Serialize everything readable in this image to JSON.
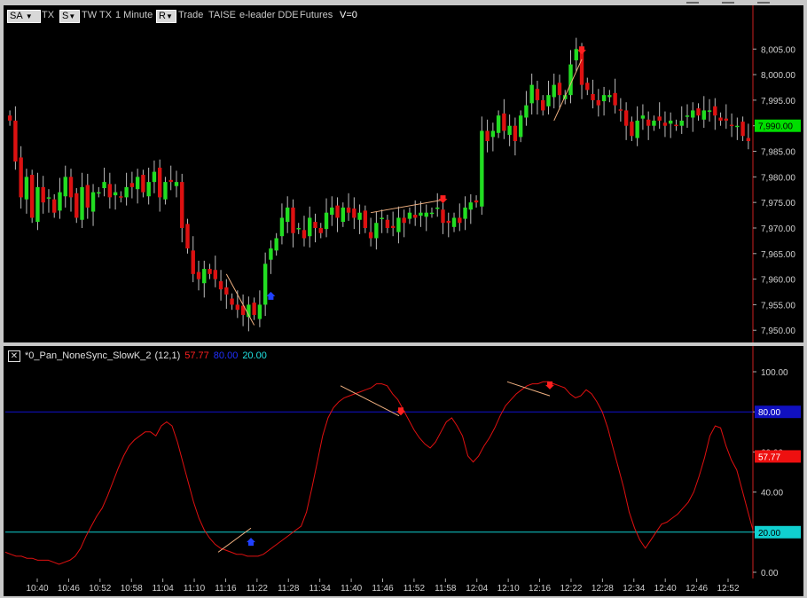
{
  "toolbar": {
    "symbol_button": "SA",
    "symbol": "TX",
    "session_button": "S",
    "exchange_symbol": "TW TX",
    "interval": "1 Minute",
    "replay_button": "R",
    "data_type": "Trade",
    "exchange": "TAISE",
    "feed": "e-leader DDE",
    "category": "Futures",
    "volume_label": "V=0"
  },
  "indicator": {
    "name": "*0_Pan_NoneSync_SlowK_2",
    "params": "(12,1)",
    "value_red": "57.77",
    "value_blue": "80.00",
    "value_cyan": "20.00"
  },
  "colors": {
    "up_candle": "#22dd22",
    "down_candle": "#dd1111",
    "slowk_line": "#e01010",
    "overbought_line": "#1010d0",
    "oversold_line": "#10d0d0",
    "divergence_line": "#f0b080",
    "sell_marker": "#ff2020",
    "buy_marker": "#2040ff",
    "price_tag": "#00dd00"
  },
  "chart_data": [
    {
      "type": "candlestick",
      "title": "TX 1 Minute",
      "ylim": [
        7949,
        8008
      ],
      "y_ticks": [
        "8,005.00",
        "8,000.00",
        "7,995.00",
        "7,990.00",
        "7,985.00",
        "7,980.00",
        "7,975.00",
        "7,970.00",
        "7,965.00",
        "7,960.00",
        "7,955.00",
        "7,950.00"
      ],
      "last_price": "7,990.00",
      "x_ticks": [
        "10:40",
        "10:46",
        "10:52",
        "10:58",
        "11:04",
        "11:10",
        "11:16",
        "11:22",
        "11:28",
        "11:34",
        "11:40",
        "11:46",
        "11:52",
        "11:58",
        "12:04",
        "12:10",
        "12:16",
        "12:22",
        "12:28",
        "12:34",
        "12:40",
        "12:46",
        "12:52"
      ],
      "closes": [
        7991,
        7983,
        7976,
        7980,
        7972,
        7978,
        7975,
        7976,
        7973,
        7977,
        7980,
        7976,
        7972,
        7978,
        7974,
        7977,
        7977,
        7979,
        7976,
        7977,
        7976,
        7978,
        7978,
        7980,
        7977,
        7979,
        7981,
        7976,
        7979,
        7979,
        7979,
        7970,
        7966,
        7961,
        7960,
        7962,
        7961,
        7960,
        7958,
        7957,
        7955,
        7954,
        7953,
        7955,
        7953,
        7955,
        7963,
        7966,
        7968,
        7972,
        7974,
        7969,
        7970,
        7968,
        7972,
        7970,
        7969,
        7973,
        7974,
        7972,
        7974,
        7973,
        7972,
        7973,
        7970,
        7968,
        7971,
        7972,
        7970,
        7970,
        7972,
        7971,
        7973,
        7972,
        7973,
        7973,
        7973,
        7974,
        7971,
        7971,
        7972,
        7971,
        7974,
        7975,
        7975,
        7989,
        7987,
        7989,
        7992,
        7989,
        7990,
        7987,
        7992,
        7994,
        7998,
        7995,
        7993,
        7996,
        7998,
        7996,
        7996,
        8002,
        8005,
        7998,
        7997,
        7995,
        7994,
        7996,
        7996,
        7994,
        7993,
        7990,
        7988,
        7991,
        7992,
        7990,
        7991,
        7991,
        7990,
        7991,
        7990,
        7991,
        7992,
        7993,
        7992,
        7993,
        7993,
        7992,
        7991,
        7991,
        7990,
        7990,
        7988,
        7987
      ],
      "series": [
        {
          "name": "up"
        },
        {
          "name": "down"
        }
      ]
    },
    {
      "type": "line",
      "ylim": [
        0,
        100
      ],
      "y_ticks": [
        "100.00",
        "80.00",
        "60.00",
        "40.00",
        "20.00",
        "0.00"
      ],
      "levels": [
        80,
        20
      ],
      "last_value": 57.77,
      "values": [
        10,
        9,
        8,
        8,
        7,
        7,
        6,
        6,
        6,
        5,
        4,
        5,
        6,
        8,
        12,
        18,
        23,
        28,
        32,
        38,
        45,
        52,
        58,
        63,
        66,
        68,
        70,
        70,
        68,
        73,
        75,
        73,
        65,
        55,
        45,
        35,
        27,
        21,
        17,
        14,
        12,
        11,
        10,
        9,
        9,
        8,
        8,
        8,
        9,
        11,
        13,
        15,
        17,
        19,
        21,
        23,
        30,
        42,
        55,
        68,
        77,
        82,
        85,
        87,
        88,
        89,
        90,
        91,
        92,
        94,
        94,
        93,
        89,
        86,
        81,
        76,
        71,
        67,
        64,
        62,
        65,
        70,
        75,
        77,
        73,
        68,
        58,
        55,
        58,
        63,
        67,
        72,
        78,
        83,
        86,
        89,
        91,
        93,
        94,
        94,
        95,
        95,
        94,
        93,
        92,
        89,
        87,
        88,
        91,
        89,
        85,
        80,
        72,
        62,
        52,
        42,
        30,
        22,
        16,
        12,
        16,
        20,
        24,
        25,
        27,
        29,
        32,
        35,
        40,
        48,
        57,
        68,
        73,
        72,
        63,
        56,
        51,
        41,
        31,
        21
      ]
    }
  ]
}
